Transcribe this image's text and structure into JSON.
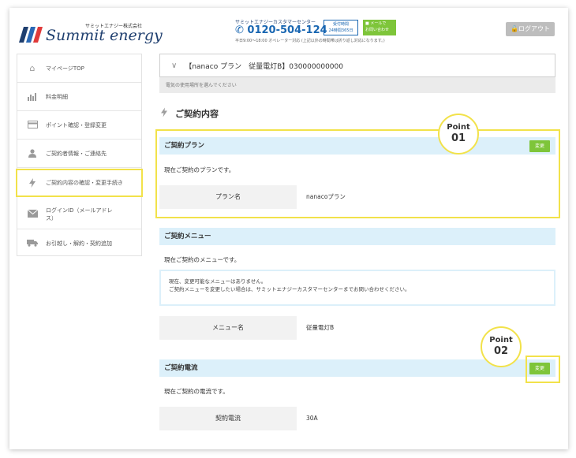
{
  "header": {
    "logo_small": "サミットエナジー株式会社",
    "logo_main": "Summit energy",
    "cc_title": "サミットエナジーカスタマーセンター",
    "phone": "0120-504-124",
    "badge_line1": "受付時間",
    "badge_line2": "24時間365日",
    "mail_line1": "メールで",
    "mail_line2": "お問い合わせ",
    "note": "平日9:00〜18:00 オペレーター対応 (上記以外の時間帯は折り返し対応になります。)",
    "logout": "ログアウト"
  },
  "sidebar": {
    "items": [
      {
        "label": "マイページTOP",
        "icon": "home-icon"
      },
      {
        "label": "料金明細",
        "icon": "bar-chart-icon"
      },
      {
        "label": "ポイント確認・登録変更",
        "icon": "card-icon"
      },
      {
        "label": "ご契約者情報・ご連絡先",
        "icon": "user-icon"
      },
      {
        "label": "ご契約内容の確認・変更手続き",
        "icon": "bolt-icon"
      },
      {
        "label": "ログインID（メールアドレス）",
        "icon": "mail-icon"
      },
      {
        "label": "お引越し・解約・契約追加",
        "icon": "truck-icon"
      }
    ]
  },
  "main": {
    "selector_text": "【nanaco プラン　従量電灯B】030000000000",
    "selector_hint": "電気の使用場所を選んでください",
    "section_title": "ご契約内容",
    "plan": {
      "heading": "ご契約プラン",
      "change": "変更",
      "desc": "現在ご契約のプランです。",
      "key": "プラン名",
      "value": "nanacoプラン"
    },
    "menu": {
      "heading": "ご契約メニュー",
      "desc": "現在ご契約のメニューです。",
      "notice_line1": "現在、変更可能なメニューはありません。",
      "notice_line2": "ご契約メニューを変更したい場合は、サミットエナジーカスタマーセンターまでお問い合わせください。",
      "key": "メニュー名",
      "value": "従量電灯B"
    },
    "current": {
      "heading": "ご契約電流",
      "change": "変更",
      "desc": "現在ご契約の電流です。",
      "key": "契約電流",
      "value": "30A"
    }
  },
  "callouts": [
    {
      "word": "Point",
      "num": "01"
    },
    {
      "word": "Point",
      "num": "02"
    }
  ],
  "colors": {
    "accent_green": "#7ec53a",
    "highlight_yellow": "#f2e24a",
    "band_blue": "#dcf0fa",
    "brand_navy": "#1f3f6f"
  }
}
